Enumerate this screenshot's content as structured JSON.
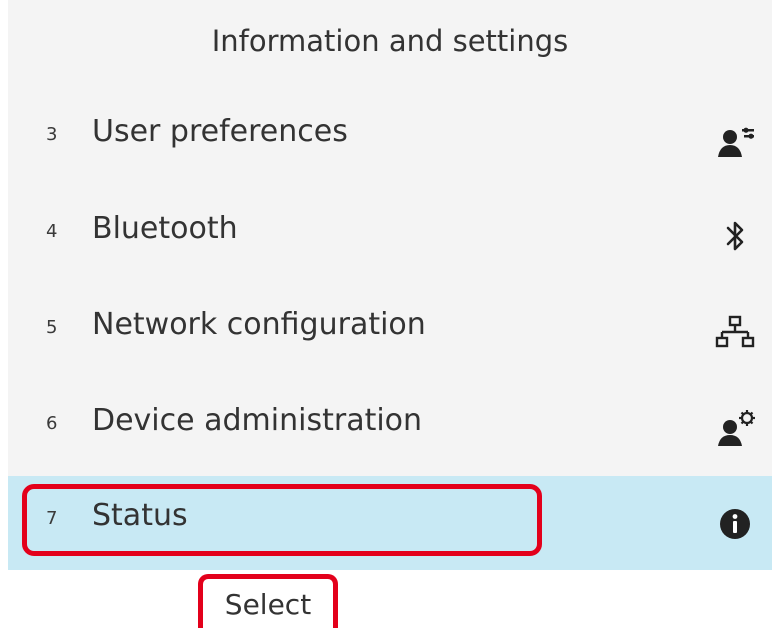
{
  "header": {
    "title": "Information and settings"
  },
  "menu": {
    "items": [
      {
        "number": "3",
        "label": "User preferences",
        "icon": "user-preferences-icon"
      },
      {
        "number": "4",
        "label": "Bluetooth",
        "icon": "bluetooth-icon"
      },
      {
        "number": "5",
        "label": "Network configuration",
        "icon": "network-icon"
      },
      {
        "number": "6",
        "label": "Device administration",
        "icon": "device-admin-icon"
      },
      {
        "number": "7",
        "label": "Status",
        "icon": "info-icon"
      }
    ],
    "selected_index": 4
  },
  "softkeys": {
    "select_label": "Select"
  },
  "colors": {
    "selected_row": "#c8e9f4",
    "annotation_red": "#e3001b"
  }
}
